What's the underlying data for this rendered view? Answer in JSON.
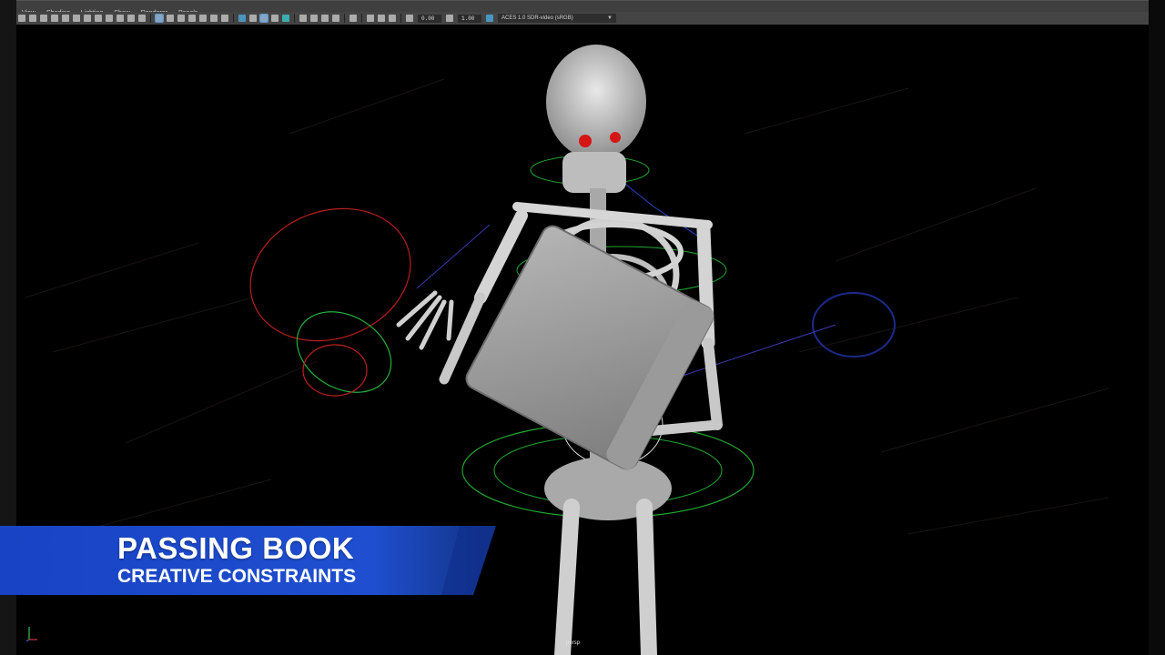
{
  "menubar": {
    "items": [
      "View",
      "Shading",
      "Lighting",
      "Show",
      "Renderer",
      "Panels"
    ]
  },
  "toolbar": {
    "exposure_value": "0.00",
    "gamma_value": "1.00",
    "color_transform": "ACES 1.0 SDR-video (sRGB)"
  },
  "viewport": {
    "camera_label": "persp"
  },
  "overlay": {
    "title": "PASSING BOOK",
    "subtitle": "CREATIVE CONSTRAINTS",
    "banner_color": "#1f47c9"
  },
  "icons": [
    "camera-icon",
    "select-icon",
    "wireframe-icon",
    "smooth-shade-icon",
    "texture-icon",
    "light-icon",
    "shadow-icon",
    "isolate-icon",
    "xray-icon",
    "grid-icon",
    "exposure-icon",
    "gamma-icon",
    "color-management-icon"
  ]
}
